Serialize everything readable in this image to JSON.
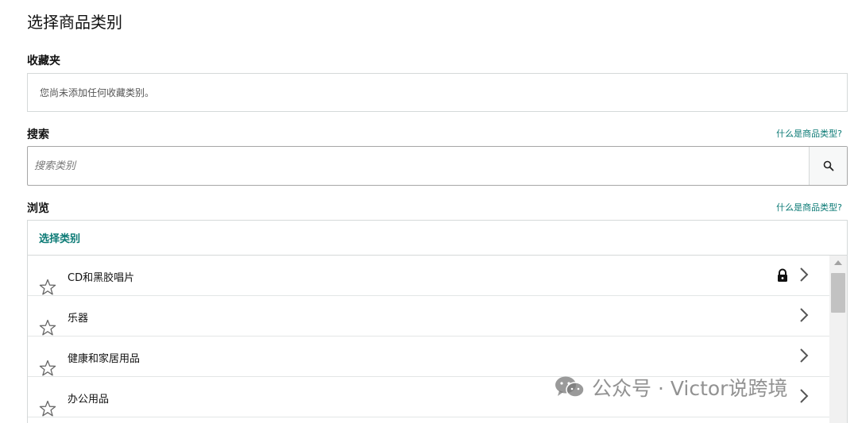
{
  "page": {
    "title": "选择商品类别"
  },
  "favorites": {
    "label": "收藏夹",
    "empty_text": "您尚未添加任何收藏类别。"
  },
  "search": {
    "label": "搜索",
    "help_link": "什么是商品类型?",
    "placeholder": "搜索类别",
    "button_icon": "search-icon"
  },
  "browse": {
    "label": "浏览",
    "help_link": "什么是商品类型?",
    "header": "选择类别",
    "items": [
      {
        "label": "CD和黑胶唱片",
        "locked": true
      },
      {
        "label": "乐器",
        "locked": false
      },
      {
        "label": "健康和家居用品",
        "locked": false
      },
      {
        "label": "办公用品",
        "locked": false
      }
    ]
  },
  "watermark": {
    "text": "公众号 · Victor说跨境",
    "icon": "wechat-icon"
  },
  "colors": {
    "accent": "#0b7a75",
    "text": "#111111",
    "border": "#d5d9d9"
  }
}
